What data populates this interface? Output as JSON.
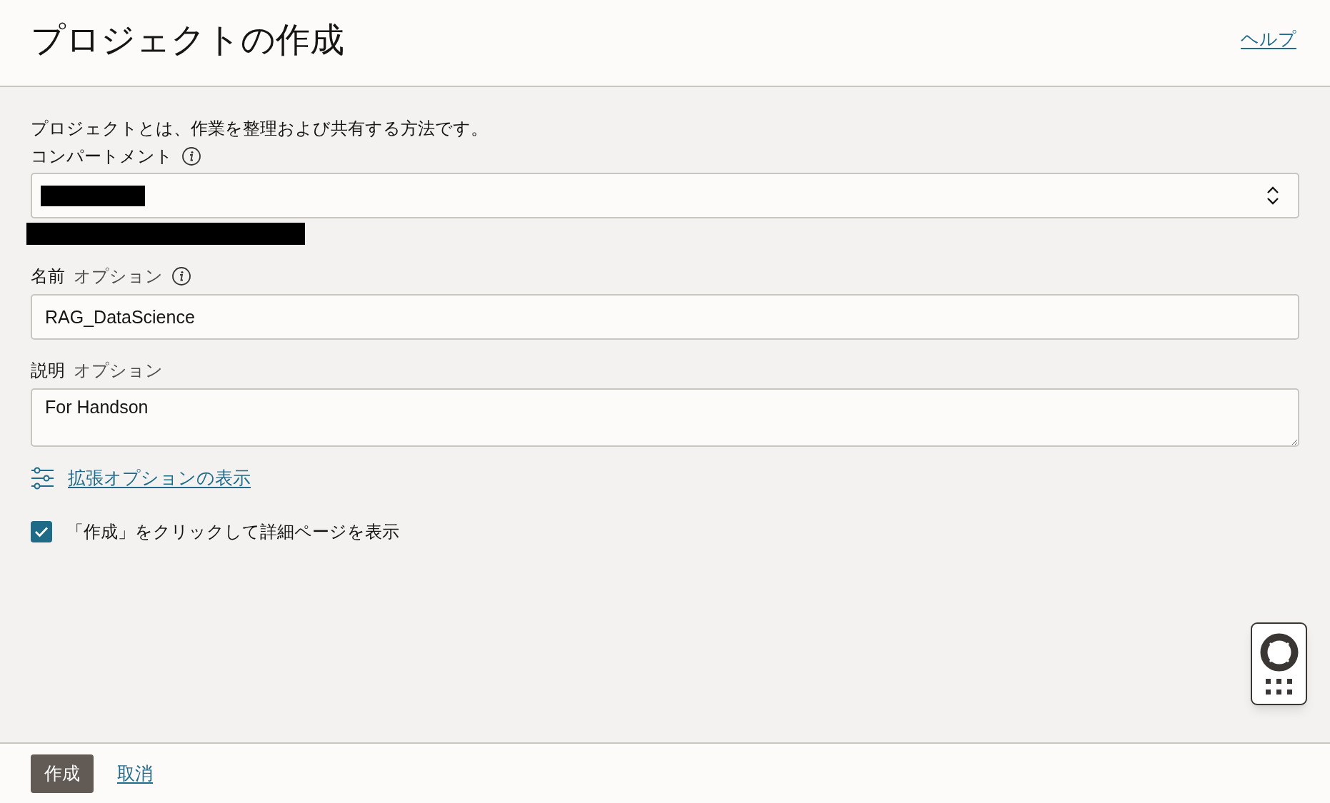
{
  "page": {
    "title": "プロジェクトの作成",
    "help_link": "ヘルプ"
  },
  "form": {
    "intro": "プロジェクトとは、作業を整理および共有する方法です。",
    "compartment": {
      "label": "コンパートメント"
    },
    "name": {
      "label": "名前",
      "optional": "オプション",
      "value": "RAG_DataScience"
    },
    "description": {
      "label": "説明",
      "optional": "オプション",
      "value": "For Handson"
    },
    "advanced_link": "拡張オプションの表示",
    "view_details": {
      "label": "「作成」をクリックして詳細ページを表示",
      "checked": true
    }
  },
  "footer": {
    "buttons": [
      {
        "label": "作成",
        "kind": "primary"
      },
      {
        "label": "取消",
        "kind": "link"
      }
    ]
  }
}
